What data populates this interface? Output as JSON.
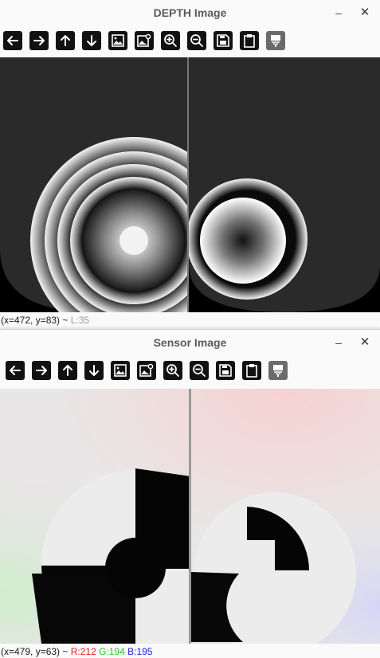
{
  "depth_window": {
    "title": "DEPTH Image",
    "minimize": "–",
    "close": "✕",
    "status": {
      "coords": "(x=472, y=83) ~",
      "value": " L:35"
    }
  },
  "sensor_window": {
    "title": "Sensor Image",
    "minimize": "–",
    "close": "✕",
    "status": {
      "coords": "(x=479, y=63) ~",
      "r": " R:212",
      "g": " G:194",
      "b": " B:195"
    }
  },
  "toolbar_icons": [
    "arrow-left-icon",
    "arrow-right-icon",
    "arrow-up-icon",
    "arrow-down-icon",
    "image-icon",
    "image-settings-icon",
    "zoom-in-icon",
    "zoom-out-icon",
    "save-icon",
    "clipboard-icon",
    "paint-icon"
  ],
  "colors": {
    "status_r": "#e02020",
    "status_g": "#22cc22",
    "status_b": "#2020e0"
  }
}
